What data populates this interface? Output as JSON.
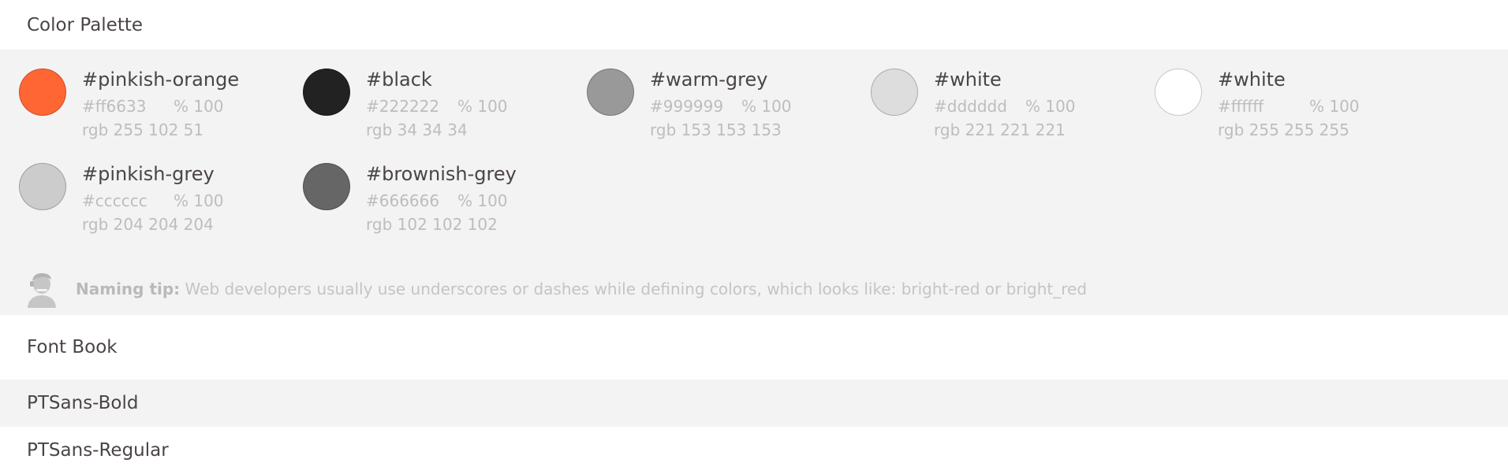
{
  "color_palette": {
    "title": "Color Palette",
    "swatches": [
      {
        "name": "#pinkish-orange",
        "hex": "#ff6633",
        "opacity": "% 100",
        "rgb": "rgb 255 102 51",
        "color": "#ff6633"
      },
      {
        "name": "#black",
        "hex": "#222222",
        "opacity": "% 100",
        "rgb": "rgb 34 34 34",
        "color": "#222222"
      },
      {
        "name": "#warm-grey",
        "hex": "#999999",
        "opacity": "% 100",
        "rgb": "rgb 153 153 153",
        "color": "#999999"
      },
      {
        "name": "#white",
        "hex": "#dddddd",
        "opacity": "% 100",
        "rgb": "rgb 221 221 221",
        "color": "#dddddd"
      },
      {
        "name": "#white",
        "hex": "#ffffff",
        "opacity": "% 100",
        "rgb": "rgb 255 255 255",
        "color": "#ffffff"
      },
      {
        "name": "#pinkish-grey",
        "hex": "#cccccc",
        "opacity": "% 100",
        "rgb": "rgb 204 204 204",
        "color": "#cccccc"
      },
      {
        "name": "#brownish-grey",
        "hex": "#666666",
        "opacity": "% 100",
        "rgb": "rgb 102 102 102",
        "color": "#666666"
      }
    ],
    "tip": {
      "icon": "person-avatar-icon",
      "label": "Naming tip:",
      "text": "Web developers usually use underscores or dashes while defining colors, which looks like: bright-red or bright_red"
    }
  },
  "font_book": {
    "title": "Font Book",
    "fonts": [
      {
        "name": "PTSans-Bold"
      },
      {
        "name": "PTSans-Regular"
      }
    ]
  }
}
